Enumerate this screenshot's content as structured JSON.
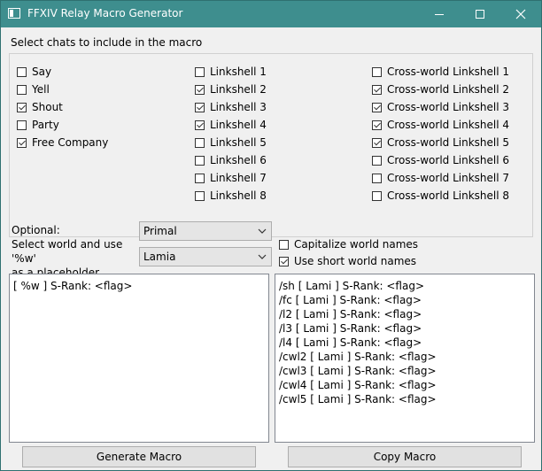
{
  "window": {
    "title": "FFXIV Relay Macro Generator"
  },
  "chats": {
    "label": "Select chats to include in the macro",
    "col1": [
      {
        "label": "Say",
        "checked": false
      },
      {
        "label": "Yell",
        "checked": false
      },
      {
        "label": "Shout",
        "checked": true
      },
      {
        "label": "Party",
        "checked": false
      },
      {
        "label": "Free Company",
        "checked": true
      }
    ],
    "col2": [
      {
        "label": "Linkshell 1",
        "checked": false
      },
      {
        "label": "Linkshell 2",
        "checked": true
      },
      {
        "label": "Linkshell 3",
        "checked": true
      },
      {
        "label": "Linkshell 4",
        "checked": true
      },
      {
        "label": "Linkshell 5",
        "checked": false
      },
      {
        "label": "Linkshell 6",
        "checked": false
      },
      {
        "label": "Linkshell 7",
        "checked": false
      },
      {
        "label": "Linkshell 8",
        "checked": false
      }
    ],
    "col3": [
      {
        "label": "Cross-world Linkshell 1",
        "checked": false
      },
      {
        "label": "Cross-world Linkshell 2",
        "checked": true
      },
      {
        "label": "Cross-world Linkshell 3",
        "checked": true
      },
      {
        "label": "Cross-world Linkshell 4",
        "checked": true
      },
      {
        "label": "Cross-world Linkshell 5",
        "checked": true
      },
      {
        "label": "Cross-world Linkshell 6",
        "checked": false
      },
      {
        "label": "Cross-world Linkshell 7",
        "checked": false
      },
      {
        "label": "Cross-world Linkshell 8",
        "checked": false
      }
    ]
  },
  "optional": {
    "line1": "Optional:",
    "line2": "Select world and use '%w'",
    "line3": "as a placeholder.",
    "datacenter": "Primal",
    "world": "Lamia",
    "capitalize": {
      "label": "Capitalize world names",
      "checked": false
    },
    "short_names": {
      "label": "Use short world names",
      "checked": true
    }
  },
  "input_text": [
    "[ %w ] S-Rank: <flag>"
  ],
  "output_text": [
    "/sh [ Lami ] S-Rank: <flag>",
    "/fc [ Lami ] S-Rank: <flag>",
    "/l2 [ Lami ] S-Rank: <flag>",
    "/l3 [ Lami ] S-Rank: <flag>",
    "/l4 [ Lami ] S-Rank: <flag>",
    "/cwl2 [ Lami ] S-Rank: <flag>",
    "/cwl3 [ Lami ] S-Rank: <flag>",
    "/cwl4 [ Lami ] S-Rank: <flag>",
    "/cwl5 [ Lami ] S-Rank: <flag>"
  ],
  "buttons": {
    "generate": "Generate Macro",
    "copy": "Copy Macro"
  },
  "colors": {
    "titlebar": "#3e8e8e",
    "window_bg": "#f0f0f0"
  }
}
